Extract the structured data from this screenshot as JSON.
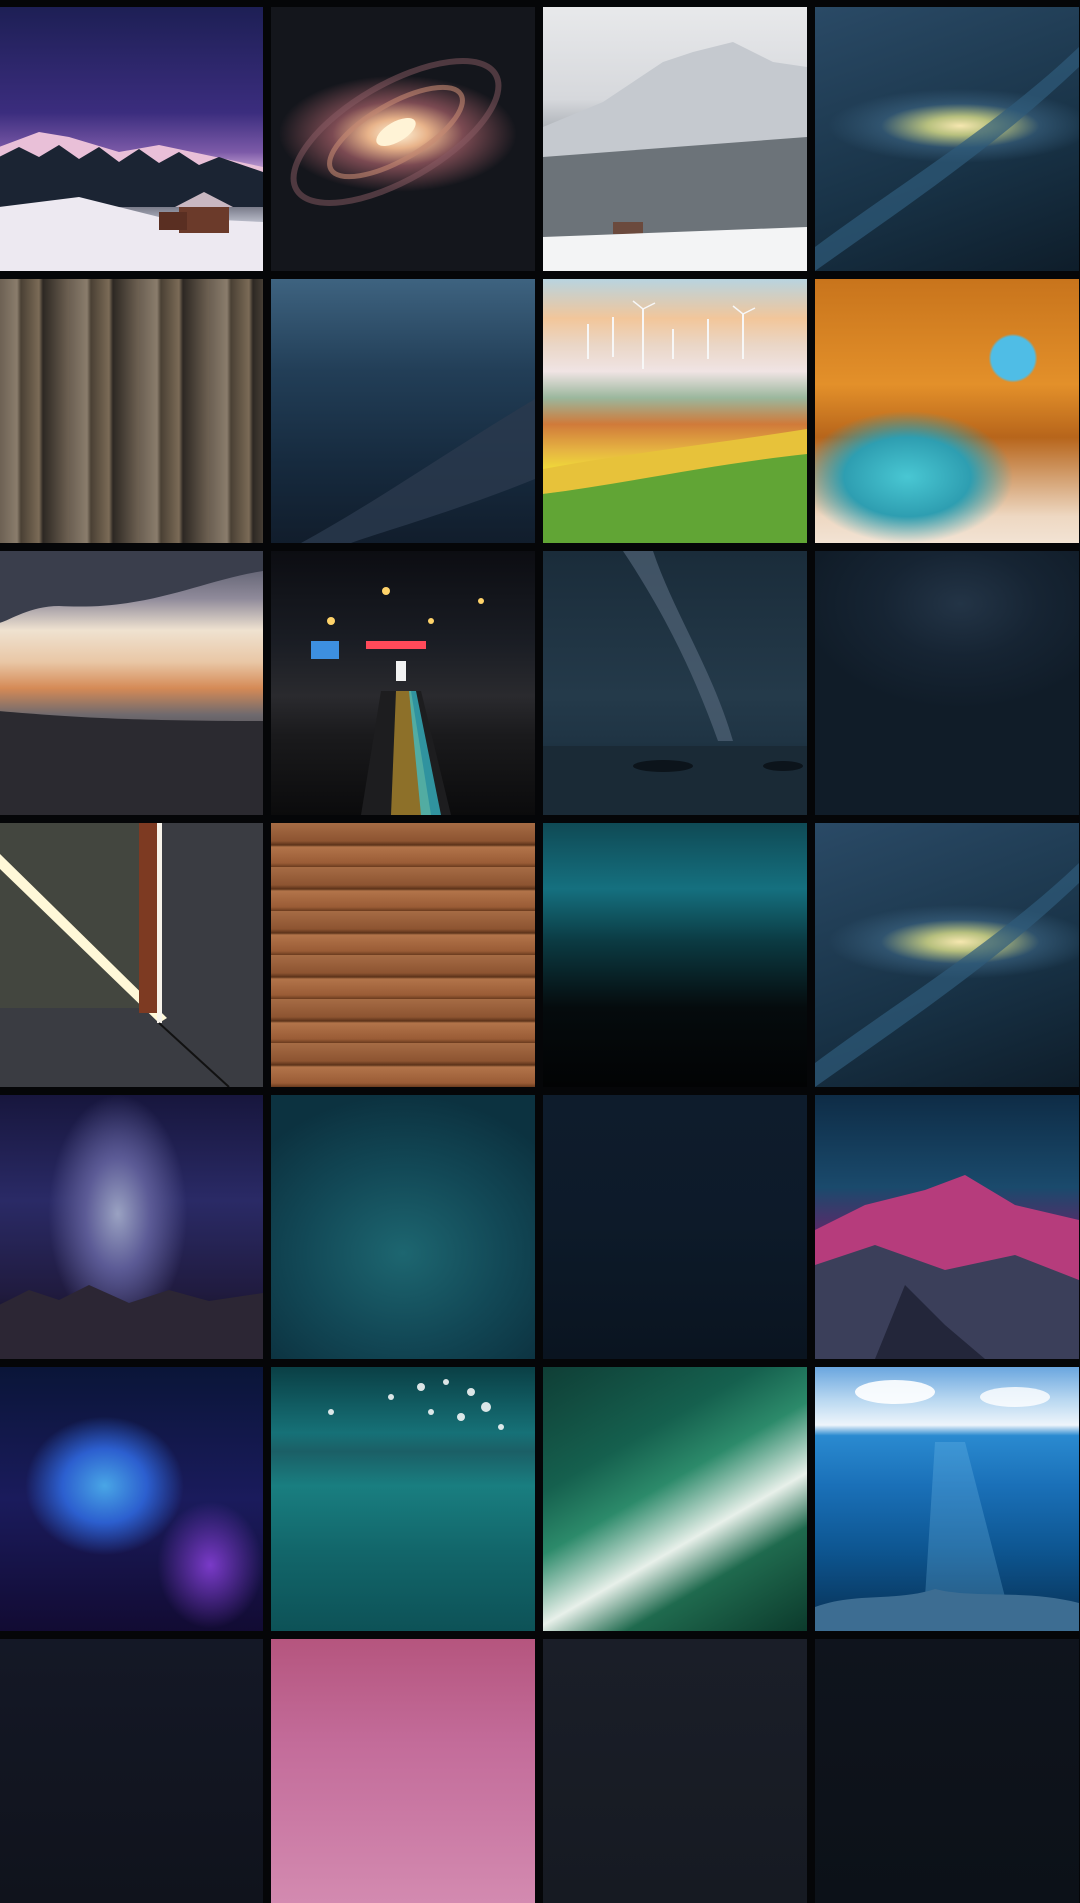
{
  "gallery": {
    "name": "wallpaper-grid",
    "columns": 4,
    "tiles": [
      {
        "id": 1,
        "subject": "snowy-mountain-cabin-night"
      },
      {
        "id": 2,
        "subject": "spiral-galaxy"
      },
      {
        "id": 3,
        "subject": "winter-forest-mountain"
      },
      {
        "id": 4,
        "subject": "blue-galaxy-sky"
      },
      {
        "id": 5,
        "subject": "weathered-wood-panel"
      },
      {
        "id": 6,
        "subject": "dark-blue-sky-milky-way"
      },
      {
        "id": 7,
        "subject": "wind-turbines-fields"
      },
      {
        "id": 8,
        "subject": "sea-cave-beach"
      },
      {
        "id": 9,
        "subject": "sunset-shoreline"
      },
      {
        "id": 10,
        "subject": "city-street-night-lights"
      },
      {
        "id": 11,
        "subject": "milky-way-over-sea"
      },
      {
        "id": 12,
        "subject": "dark-gradient"
      },
      {
        "id": 13,
        "subject": "light-slit-abstract"
      },
      {
        "id": 14,
        "subject": "wood-floor-planks"
      },
      {
        "id": 15,
        "subject": "teal-nebula-dark"
      },
      {
        "id": 16,
        "subject": "blue-galaxy-sky"
      },
      {
        "id": 17,
        "subject": "milky-way-mountains"
      },
      {
        "id": 18,
        "subject": "teal-gradient"
      },
      {
        "id": 19,
        "subject": "dark-starfield"
      },
      {
        "id": 20,
        "subject": "pink-mountain-night"
      },
      {
        "id": 21,
        "subject": "blue-purple-nebula"
      },
      {
        "id": 22,
        "subject": "underwater-surface"
      },
      {
        "id": 23,
        "subject": "aerial-ocean-wave"
      },
      {
        "id": 24,
        "subject": "ocean-split-view"
      },
      {
        "id": 25,
        "subject": "dark-tile"
      },
      {
        "id": 26,
        "subject": "pink-gradient"
      },
      {
        "id": 27,
        "subject": "dark-tile"
      },
      {
        "id": 28,
        "subject": "dark-tile"
      }
    ]
  },
  "colors": {
    "background": "#050608"
  }
}
